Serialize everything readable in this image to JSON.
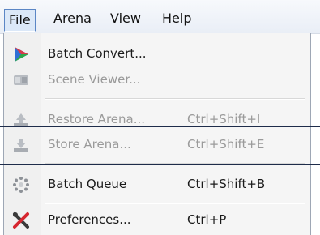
{
  "menubar": {
    "items": [
      "File",
      "Arena",
      "View",
      "Help"
    ]
  },
  "file_menu": {
    "items": [
      {
        "label": "Batch Convert...",
        "shortcut": "",
        "icon": "play-arrow-icon",
        "enabled": true
      },
      {
        "label": "Scene Viewer...",
        "shortcut": "",
        "icon": "scene-viewer-icon",
        "enabled": false
      },
      {
        "label": "Restore Arena...",
        "shortcut": "Ctrl+Shift+I",
        "icon": "restore-arena-icon",
        "enabled": false
      },
      {
        "label": "Store Arena...",
        "shortcut": "Ctrl+Shift+E",
        "icon": "store-arena-icon",
        "enabled": false
      },
      {
        "label": "Batch Queue",
        "shortcut": "Ctrl+Shift+B",
        "icon": "batch-queue-icon",
        "enabled": true
      },
      {
        "label": "Preferences...",
        "shortcut": "Ctrl+P",
        "icon": "wrench-screwdriver-icon",
        "enabled": true
      }
    ]
  },
  "colors": {
    "menubar_active_bg": "#dbe8f8",
    "menubar_active_border": "#5b86c5",
    "disabled_text": "#9a9a9a",
    "menu_bg": "#f5f5f5"
  }
}
